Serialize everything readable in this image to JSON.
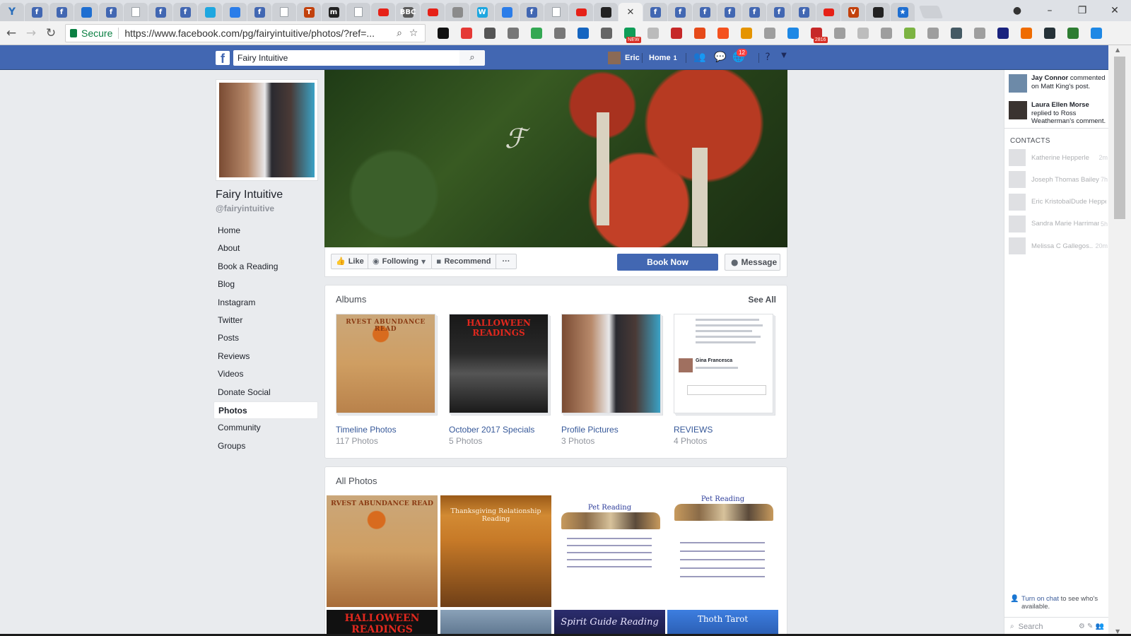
{
  "browser": {
    "tabs": [
      {
        "icon": "y-icon",
        "glyph": "Y"
      },
      {
        "icon": "facebook-icon",
        "glyph": "f"
      },
      {
        "icon": "facebook-icon",
        "glyph": "f"
      },
      {
        "icon": "avatar-tab-icon",
        "glyph": ""
      },
      {
        "icon": "facebook-icon",
        "glyph": "f"
      },
      {
        "icon": "document-icon",
        "glyph": ""
      },
      {
        "icon": "facebook-icon",
        "glyph": "f"
      },
      {
        "icon": "facebook-icon",
        "glyph": "f"
      },
      {
        "icon": "globe-icon",
        "glyph": ""
      },
      {
        "icon": "pin-icon",
        "glyph": ""
      },
      {
        "icon": "facebook-icon",
        "glyph": "f"
      },
      {
        "icon": "document-icon",
        "glyph": ""
      },
      {
        "icon": "nyt-icon",
        "glyph": "T"
      },
      {
        "icon": "m-icon",
        "glyph": "m"
      },
      {
        "icon": "document-icon",
        "glyph": ""
      },
      {
        "icon": "youtube-icon",
        "glyph": ""
      },
      {
        "icon": "bbc-icon",
        "glyph": "BBC"
      },
      {
        "icon": "youtube-icon",
        "glyph": ""
      },
      {
        "icon": "image-icon",
        "glyph": ""
      },
      {
        "icon": "wikipedia-icon",
        "glyph": "W"
      },
      {
        "icon": "shield-icon",
        "glyph": ""
      },
      {
        "icon": "facebook-icon",
        "glyph": "f"
      },
      {
        "icon": "document-icon",
        "glyph": ""
      },
      {
        "icon": "youtube-icon",
        "glyph": ""
      },
      {
        "icon": "circle-icon",
        "glyph": ""
      },
      {
        "icon": "close-icon",
        "glyph": "✕",
        "active": true
      },
      {
        "icon": "facebook-icon",
        "glyph": "f"
      },
      {
        "icon": "facebook-icon",
        "glyph": "f"
      },
      {
        "icon": "facebook-icon",
        "glyph": "f"
      },
      {
        "icon": "facebook-icon",
        "glyph": "f"
      },
      {
        "icon": "facebook-icon",
        "glyph": "f"
      },
      {
        "icon": "facebook-icon",
        "glyph": "f"
      },
      {
        "icon": "facebook-icon",
        "glyph": "f"
      },
      {
        "icon": "youtube-icon",
        "glyph": ""
      },
      {
        "icon": "v-icon",
        "glyph": "V"
      },
      {
        "icon": "messenger-icon",
        "glyph": ""
      },
      {
        "icon": "star-icon",
        "glyph": "★"
      }
    ],
    "address": {
      "secure_label": "Secure",
      "url": "https://www.facebook.com/pg/fairyintuitive/photos/?ref=..."
    },
    "extension_badge_new": "NEW",
    "extension_badge_mail": "2816"
  },
  "fb": {
    "search_value": "Fairy Intuitive",
    "user_name": "Eric",
    "home_label": "Home",
    "home_count": "1",
    "notification_count": "12"
  },
  "page": {
    "name": "Fairy Intuitive",
    "handle": "@fairyintuitive",
    "nav": [
      {
        "label": "Home"
      },
      {
        "label": "About"
      },
      {
        "label": "Book a Reading"
      },
      {
        "label": "Blog"
      },
      {
        "label": "Instagram"
      },
      {
        "label": "Twitter"
      },
      {
        "label": "Posts"
      },
      {
        "label": "Reviews"
      },
      {
        "label": "Videos"
      },
      {
        "label": "Donate Social"
      },
      {
        "label": "Photos",
        "active": true
      },
      {
        "label": "Community"
      },
      {
        "label": "Groups"
      }
    ]
  },
  "actions": {
    "like": "Like",
    "following": "Following",
    "recommend": "Recommend",
    "more": "···",
    "book_now": "Book Now",
    "message": "Message"
  },
  "albums": {
    "title": "Albums",
    "see_all": "See All",
    "items": [
      {
        "name": "Timeline Photos",
        "count": "117 Photos",
        "thumb_text": "RVEST ABUNDANCE READ"
      },
      {
        "name": "October 2017 Specials",
        "count": "5 Photos",
        "thumb_text": "HALLOWEEN READINGS"
      },
      {
        "name": "Profile Pictures",
        "count": "3 Photos",
        "thumb_text": ""
      },
      {
        "name": "REVIEWS",
        "count": "4 Photos",
        "thumb_text": "Gina Francesca"
      }
    ]
  },
  "all_photos": {
    "title": "All Photos",
    "items": [
      {
        "text": "RVEST ABUNDANCE READ"
      },
      {
        "text": "Thanksgiving Relationship Reading"
      },
      {
        "text": "Pet Reading"
      },
      {
        "text": "Pet Reading"
      },
      {
        "text": "HALLOWEEN READINGS"
      },
      {
        "text": ""
      },
      {
        "text": "Spirit Guide Reading"
      },
      {
        "text": "Thoth Tarot"
      }
    ]
  },
  "sidebar": {
    "ticker": [
      {
        "name": "Jay Connor",
        "text": " commented on Matt King's post."
      },
      {
        "name": "Laura Ellen Morse",
        "text": " replied to Ross Weatherman's comment."
      }
    ],
    "contacts_label": "CONTACTS",
    "contacts": [
      {
        "name": "Katherine Hepperle",
        "time": "2m"
      },
      {
        "name": "Joseph Thomas Bailey",
        "time": "7h"
      },
      {
        "name": "Eric KristobalDude Hepperle",
        "time": ""
      },
      {
        "name": "Sandra Marie Harriman",
        "time": "5h"
      },
      {
        "name": "Melissa C Gallegos...",
        "time": "20m"
      }
    ],
    "chat_link": "Turn on chat",
    "chat_rest": " to see who's available.",
    "search_placeholder": "Search"
  },
  "colors": {
    "fb_blue": "#4267b2",
    "link_blue": "#365899",
    "background": "#e9ebee"
  }
}
